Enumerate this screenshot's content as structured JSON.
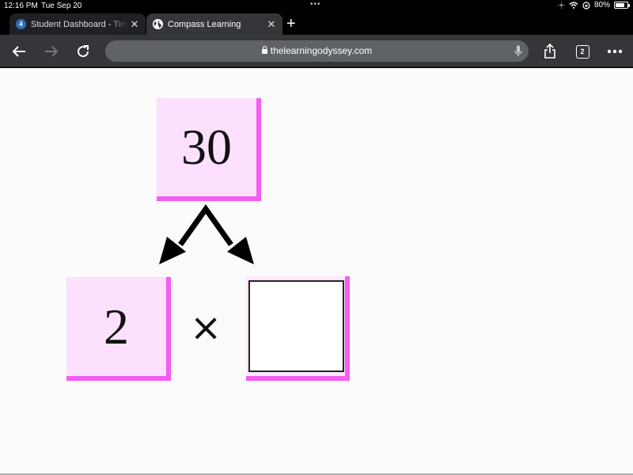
{
  "status_bar": {
    "time": "12:16 PM",
    "date": "Tue Sep 20",
    "battery_percent": "80%",
    "battery_level": 0.8,
    "icons": [
      "moon-icon",
      "wifi-icon",
      "orientation-lock-icon",
      "battery-icon"
    ]
  },
  "tabs": [
    {
      "title": "Student Dashboard - Tim",
      "favicon": "4",
      "active": false
    },
    {
      "title": "Compass Learning",
      "favicon": "globe-icon",
      "active": true
    }
  ],
  "toolbar": {
    "url": "thelearningodyssey.com",
    "tab_count": "2"
  },
  "colors": {
    "box_fill": "#fde0fd",
    "box_border": "#f55cf2",
    "chrome_dark": "#35363a",
    "url_bar": "#5f6368"
  },
  "problem": {
    "top_number": "30",
    "left_factor": "2",
    "operator": "×",
    "right_factor": ""
  }
}
